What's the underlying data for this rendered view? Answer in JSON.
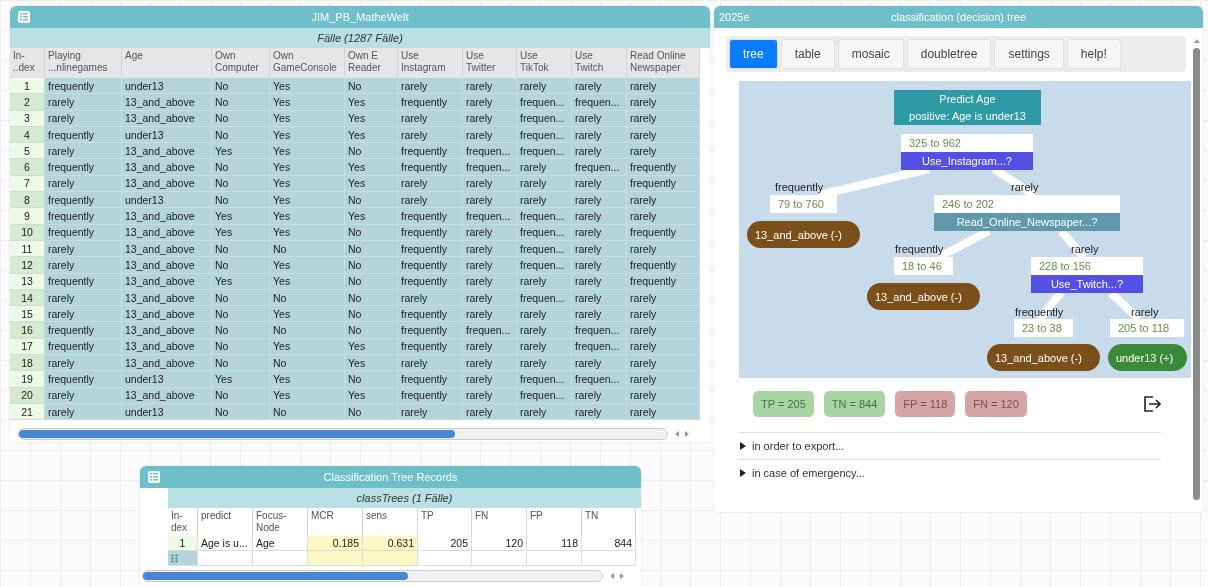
{
  "data_window": {
    "title": "JIM_PB_MatheWelt",
    "caption": "Fälle (1287 Fälle)",
    "columns": [
      "In-\n..dex",
      "Playing\n...nlinegames",
      "Age",
      "Own\nComputer",
      "Own\nGameConsole",
      "Own E\nReader",
      "Use\nInstagram",
      "Use\nTwitter",
      "Use\nTikTok",
      "Use\nTwitch",
      "Read Online\nNewspaper"
    ],
    "rows": [
      [
        "1",
        "frequently",
        "under13",
        "No",
        "Yes",
        "No",
        "rarely",
        "rarely",
        "rarely",
        "rarely",
        "rarely"
      ],
      [
        "2",
        "rarely",
        "13_and_above",
        "No",
        "Yes",
        "Yes",
        "frequently",
        "rarely",
        "frequen...",
        "frequen...",
        "rarely"
      ],
      [
        "3",
        "rarely",
        "13_and_above",
        "No",
        "Yes",
        "Yes",
        "rarely",
        "rarely",
        "frequen...",
        "rarely",
        "rarely"
      ],
      [
        "4",
        "frequently",
        "under13",
        "No",
        "Yes",
        "Yes",
        "rarely",
        "rarely",
        "frequen...",
        "rarely",
        "rarely"
      ],
      [
        "5",
        "rarely",
        "13_and_above",
        "Yes",
        "Yes",
        "No",
        "frequently",
        "frequen...",
        "frequen...",
        "rarely",
        "rarely"
      ],
      [
        "6",
        "frequently",
        "13_and_above",
        "No",
        "Yes",
        "Yes",
        "frequently",
        "frequen...",
        "rarely",
        "frequen...",
        "frequently"
      ],
      [
        "7",
        "rarely",
        "13_and_above",
        "No",
        "Yes",
        "Yes",
        "rarely",
        "rarely",
        "rarely",
        "rarely",
        "frequently"
      ],
      [
        "8",
        "frequently",
        "under13",
        "No",
        "Yes",
        "No",
        "rarely",
        "rarely",
        "rarely",
        "rarely",
        "rarely"
      ],
      [
        "9",
        "frequently",
        "13_and_above",
        "Yes",
        "Yes",
        "Yes",
        "frequently",
        "frequen...",
        "frequen...",
        "rarely",
        "rarely"
      ],
      [
        "10",
        "frequently",
        "13_and_above",
        "Yes",
        "Yes",
        "No",
        "frequently",
        "rarely",
        "frequen...",
        "rarely",
        "frequently"
      ],
      [
        "11",
        "rarely",
        "13_and_above",
        "No",
        "No",
        "No",
        "frequently",
        "rarely",
        "frequen...",
        "rarely",
        "rarely"
      ],
      [
        "12",
        "rarely",
        "13_and_above",
        "No",
        "Yes",
        "No",
        "frequently",
        "rarely",
        "frequen...",
        "rarely",
        "frequently"
      ],
      [
        "13",
        "frequently",
        "13_and_above",
        "Yes",
        "Yes",
        "No",
        "frequently",
        "rarely",
        "rarely",
        "rarely",
        "frequently"
      ],
      [
        "14",
        "rarely",
        "13_and_above",
        "No",
        "No",
        "No",
        "rarely",
        "rarely",
        "frequen...",
        "rarely",
        "rarely"
      ],
      [
        "15",
        "rarely",
        "13_and_above",
        "No",
        "Yes",
        "No",
        "frequently",
        "rarely",
        "rarely",
        "rarely",
        "rarely"
      ],
      [
        "16",
        "frequently",
        "13_and_above",
        "No",
        "No",
        "No",
        "frequently",
        "frequen...",
        "rarely",
        "frequen...",
        "rarely"
      ],
      [
        "17",
        "frequently",
        "13_and_above",
        "No",
        "Yes",
        "Yes",
        "frequently",
        "rarely",
        "rarely",
        "frequen...",
        "rarely"
      ],
      [
        "18",
        "rarely",
        "13_and_above",
        "No",
        "No",
        "Yes",
        "rarely",
        "rarely",
        "rarely",
        "rarely",
        "rarely"
      ],
      [
        "19",
        "frequently",
        "under13",
        "Yes",
        "Yes",
        "No",
        "frequently",
        "rarely",
        "frequen...",
        "frequen...",
        "rarely"
      ],
      [
        "20",
        "rarely",
        "13_and_above",
        "No",
        "Yes",
        "Yes",
        "frequently",
        "rarely",
        "frequen...",
        "rarely",
        "rarely"
      ],
      [
        "21",
        "rarely",
        "under13",
        "No",
        "No",
        "No",
        "rarely",
        "rarely",
        "rarely",
        "rarely",
        "rarely"
      ]
    ]
  },
  "records_window": {
    "title": "Classification Tree Records",
    "caption": "classTrees (1 Fälle)",
    "columns": [
      {
        "label": "In-\ndex",
        "kind": "index"
      },
      {
        "label": "predict",
        "kind": "text"
      },
      {
        "label": "Focus-\nNode",
        "kind": "text"
      },
      {
        "label": "MCR",
        "kind": "number"
      },
      {
        "label": "sens",
        "kind": "number"
      },
      {
        "label": "TP",
        "kind": "number"
      },
      {
        "label": "FN",
        "kind": "number"
      },
      {
        "label": "FP",
        "kind": "number"
      },
      {
        "label": "TN",
        "kind": "number"
      }
    ],
    "rows": [
      [
        "1",
        "Age is u...",
        "Age",
        "0.185",
        "0.631",
        "205",
        "120",
        "118",
        "844"
      ]
    ]
  },
  "tree_window": {
    "badge": "2025e",
    "title": "classification (decision) tree",
    "tabs": [
      {
        "label": "tree",
        "selected": true
      },
      {
        "label": "table",
        "selected": false
      },
      {
        "label": "mosaic",
        "selected": false
      },
      {
        "label": "doubletree",
        "selected": false
      },
      {
        "label": "settings",
        "selected": false
      },
      {
        "label": "help!",
        "selected": false
      }
    ],
    "tree": {
      "title": "Predict Age",
      "subtitle": "positive: Age is under13",
      "counts": "325 to 962",
      "kind": "split",
      "question": "Use_Instagram...?",
      "color": "#5450e6",
      "children": [
        {
          "branch": "frequently",
          "counts": "79 to 760",
          "kind": "leaf",
          "label": "13_and_above (-)",
          "positive": false
        },
        {
          "branch": "rarely",
          "counts": "246 to 202",
          "kind": "split",
          "question": "Read_Online_Newspaper...?",
          "color": "#5f99ab",
          "children": [
            {
              "branch": "frequently",
              "counts": "18 to 46",
              "kind": "leaf",
              "label": "13_and_above (-)",
              "positive": false
            },
            {
              "branch": "rarely",
              "counts": "228 to 156",
              "kind": "split",
              "question": "Use_Twitch...?",
              "color": "#5450e6",
              "children": [
                {
                  "branch": "frequently",
                  "counts": "23 to 38",
                  "kind": "leaf",
                  "label": "13_and_above (-)",
                  "positive": false
                },
                {
                  "branch": "rarely",
                  "counts": "205 to 118",
                  "kind": "leaf",
                  "label": "under13 (+)",
                  "positive": true
                }
              ]
            }
          ]
        }
      ]
    },
    "results": [
      {
        "label": "TP = 205",
        "correct": true
      },
      {
        "label": "TN = 844",
        "correct": true
      },
      {
        "label": "FP = 118",
        "correct": false
      },
      {
        "label": "FN = 120",
        "correct": false
      }
    ],
    "sections": [
      {
        "label": "in order to export...",
        "expanded": false
      },
      {
        "label": "in case of emergency...",
        "expanded": false
      }
    ]
  }
}
